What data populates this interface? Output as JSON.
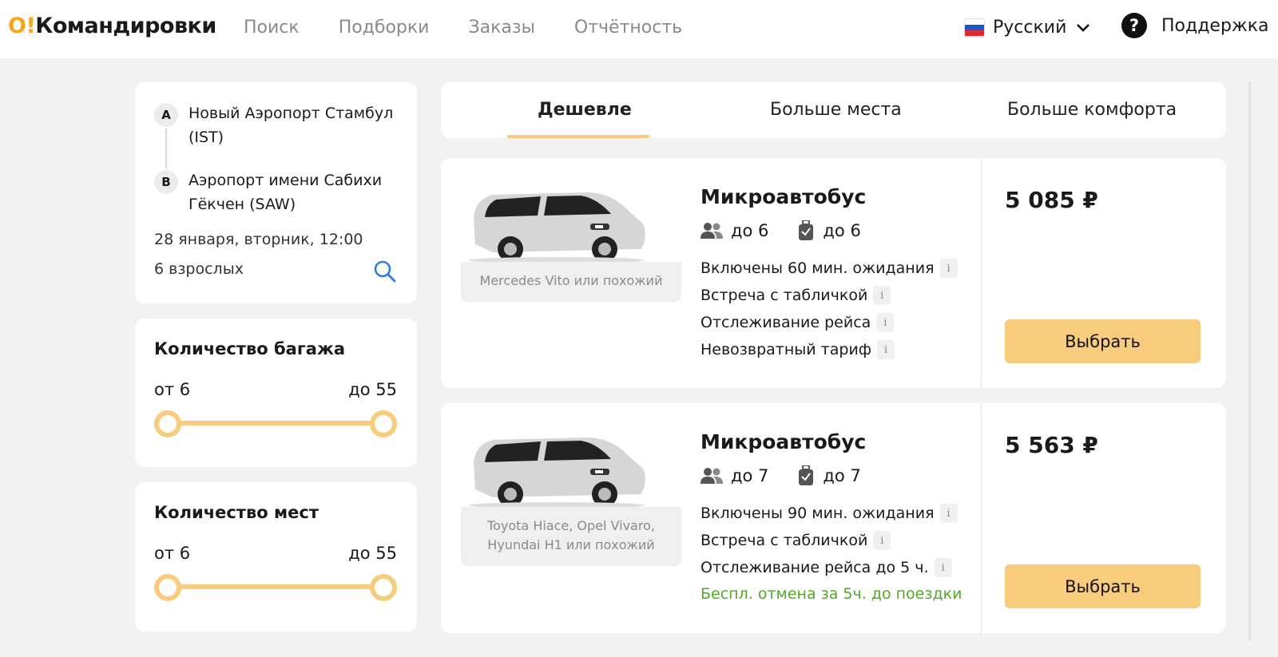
{
  "header": {
    "logo_o": "O!",
    "logo_text": "Командировки",
    "nav": [
      "Поиск",
      "Подборки",
      "Заказы",
      "Отчётность"
    ],
    "language": "Русский",
    "support": "Поддержка"
  },
  "route": {
    "point_a_letter": "A",
    "point_a": "Новый Аэропорт Стамбул (IST)",
    "point_b_letter": "B",
    "point_b": "Аэропорт имени Сабихи Гёкчен (SAW)",
    "date": "28 января, вторник, 12:00",
    "passengers": "6 взрослых"
  },
  "filters": [
    {
      "title": "Количество багажа",
      "from": "от 6",
      "to": "до 55"
    },
    {
      "title": "Количество мест",
      "from": "от 6",
      "to": "до 55"
    }
  ],
  "tabs": [
    "Дешевле",
    "Больше места",
    "Больше комфорта"
  ],
  "offers": [
    {
      "title": "Микроавтобус",
      "car_caption": "Mercedes Vito или похожий",
      "seats": "до 6",
      "luggage": "до 6",
      "features": [
        "Включены 60 мин. ожидания",
        "Встреча с табличкой",
        "Отслеживание рейса",
        "Невозвратный тариф"
      ],
      "price": "5 085 ₽",
      "button": "Выбрать"
    },
    {
      "title": "Микроавтобус",
      "car_caption": "Toyota Hiace, Opel Vivaro, Hyundai H1 или похожий",
      "seats": "до 7",
      "luggage": "до 7",
      "features": [
        "Включены 90 мин. ожидания",
        "Встреча с табличкой",
        "Отслеживание рейса до 5 ч.",
        "Беспл. отмена за 5ч. до поездки"
      ],
      "price": "5 563 ₽",
      "button": "Выбрать"
    }
  ],
  "info_glyph": "i",
  "colors": {
    "accent": "#f7cc7c",
    "logo": "#f5a623",
    "green": "#52a829"
  },
  "icons": [
    "flag-ru-icon",
    "chevron-down-icon",
    "help-icon",
    "search-icon",
    "passengers-icon",
    "luggage-icon",
    "info-icon"
  ]
}
